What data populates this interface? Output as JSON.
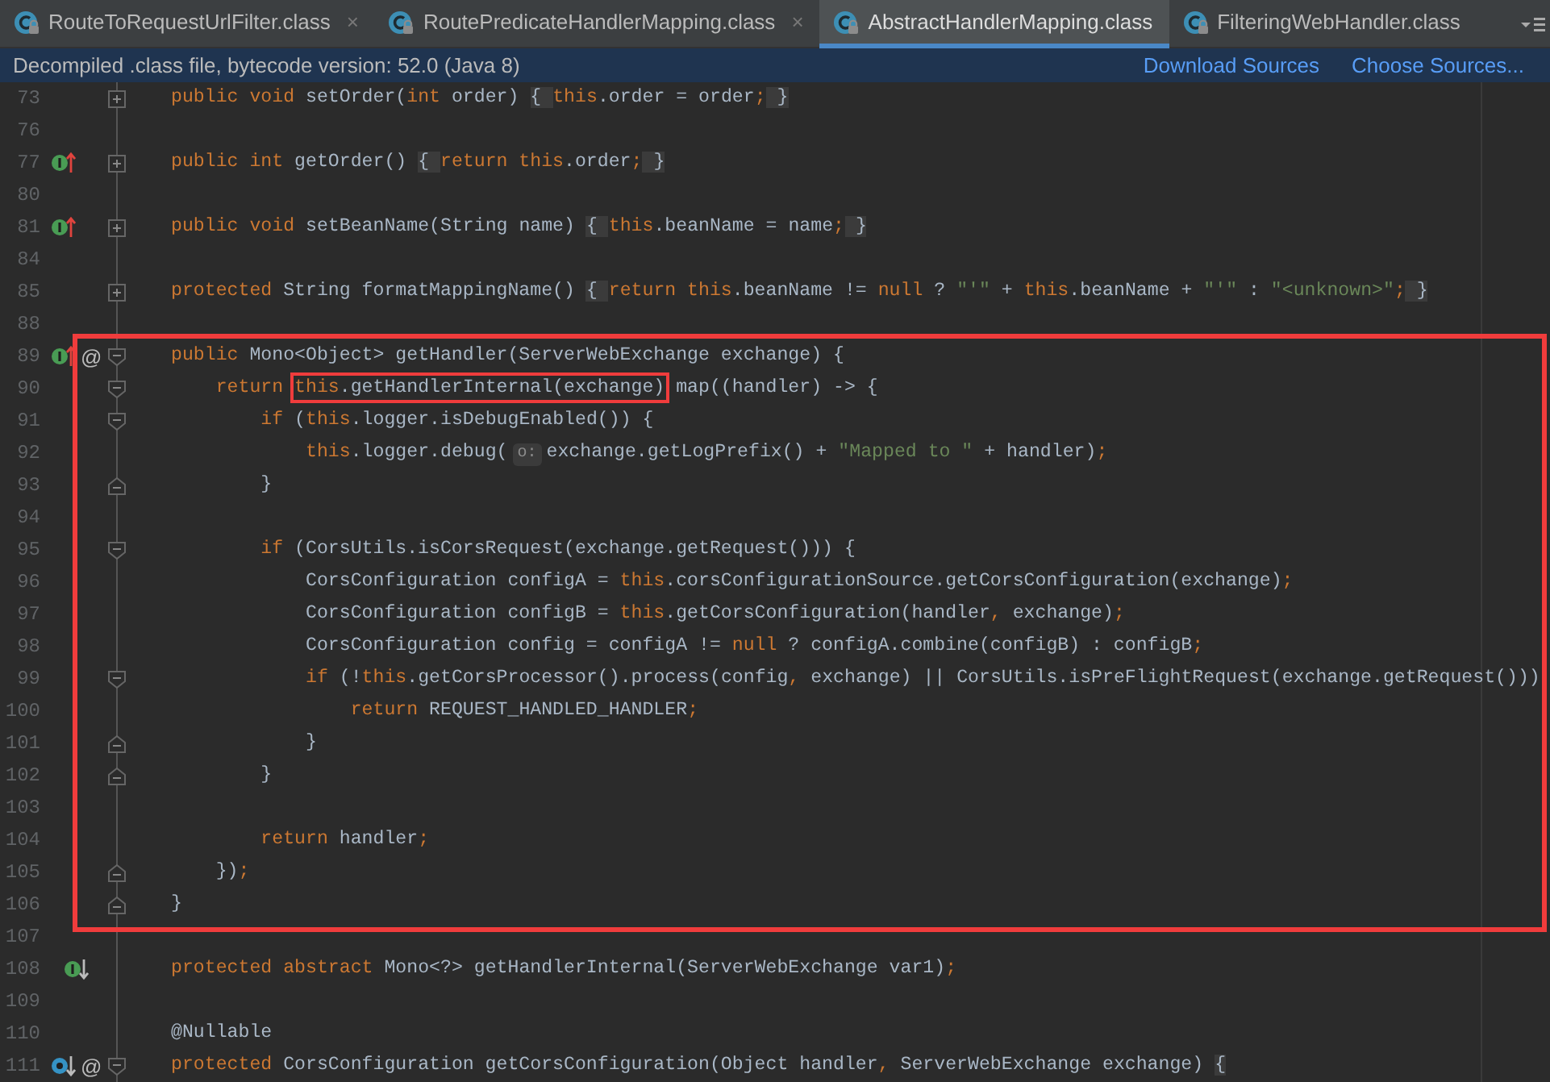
{
  "tabs": [
    {
      "label": "RouteToRequestUrlFilter.class",
      "selected": false,
      "close": "×"
    },
    {
      "label": "RoutePredicateHandlerMapping.class",
      "selected": false,
      "close": "×"
    },
    {
      "label": "AbstractHandlerMapping.class",
      "selected": true
    },
    {
      "label": "FilteringWebHandler.class",
      "selected": false
    }
  ],
  "notice": {
    "text": "Decompiled .class file, bytecode version: 52.0 (Java 8)",
    "links": [
      "Download Sources",
      "Choose Sources..."
    ]
  },
  "blocks": [
    {
      "framed": false,
      "lines": [
        {
          "number": "73",
          "fold": {
            "kind": "collapsed"
          },
          "tokens": [
            {
              "kind": "kw",
              "text": "public void "
            },
            {
              "kind": "plain",
              "text": "setOrder("
            },
            {
              "kind": "kw",
              "text": "int "
            },
            {
              "kind": "plain",
              "text": "order) "
            },
            {
              "kind": "fold",
              "text": "{ "
            },
            {
              "kind": "kw",
              "text": "this"
            },
            {
              "kind": "plain",
              "text": ".order = order"
            },
            {
              "kind": "kw",
              "text": ";"
            },
            {
              "kind": "fold",
              "text": " }"
            }
          ]
        },
        {
          "number": "76"
        },
        {
          "number": "77",
          "gutter": {
            "kind": "override"
          },
          "fold": {
            "kind": "collapsed"
          },
          "tokens": [
            {
              "kind": "kw",
              "text": "public int "
            },
            {
              "kind": "plain",
              "text": "getOrder() "
            },
            {
              "kind": "fold",
              "text": "{ "
            },
            {
              "kind": "kw",
              "text": "return this"
            },
            {
              "kind": "plain",
              "text": ".order"
            },
            {
              "kind": "kw",
              "text": ";"
            },
            {
              "kind": "fold",
              "text": " }"
            }
          ]
        },
        {
          "number": "80"
        },
        {
          "number": "81",
          "gutter": {
            "kind": "override"
          },
          "fold": {
            "kind": "collapsed"
          },
          "tokens": [
            {
              "kind": "kw",
              "text": "public void "
            },
            {
              "kind": "plain",
              "text": "setBeanName(String name) "
            },
            {
              "kind": "fold",
              "text": "{ "
            },
            {
              "kind": "kw",
              "text": "this"
            },
            {
              "kind": "plain",
              "text": ".beanName = name"
            },
            {
              "kind": "kw",
              "text": ";"
            },
            {
              "kind": "fold",
              "text": " }"
            }
          ]
        },
        {
          "number": "84"
        },
        {
          "number": "85",
          "fold": {
            "kind": "collapsed"
          },
          "tokens": [
            {
              "kind": "kw",
              "text": "protected "
            },
            {
              "kind": "plain",
              "text": "String formatMappingName() "
            },
            {
              "kind": "fold",
              "text": "{ "
            },
            {
              "kind": "kw",
              "text": "return this"
            },
            {
              "kind": "plain",
              "text": ".beanName != "
            },
            {
              "kind": "kw",
              "text": "null "
            },
            {
              "kind": "plain",
              "text": "? "
            },
            {
              "kind": "str",
              "text": "\"'\""
            },
            {
              "kind": "plain",
              "text": " + "
            },
            {
              "kind": "kw",
              "text": "this"
            },
            {
              "kind": "plain",
              "text": ".beanName + "
            },
            {
              "kind": "str",
              "text": "\"'\""
            },
            {
              "kind": "plain",
              "text": " : "
            },
            {
              "kind": "str",
              "text": "\"<unknown>\""
            },
            {
              "kind": "kw",
              "text": ";"
            },
            {
              "kind": "fold",
              "text": " }"
            }
          ]
        },
        {
          "number": "88"
        }
      ]
    },
    {
      "framed": true,
      "lines": [
        {
          "number": "89",
          "gutter": {
            "kind": "override"
          },
          "mark": "@",
          "fold": {
            "kind": "start"
          },
          "tokens": [
            {
              "kind": "kw",
              "text": "public "
            },
            {
              "kind": "plain",
              "text": "Mono<Object> getHandler(ServerWebExchange exchange) {"
            }
          ]
        },
        {
          "number": "90",
          "fold": {
            "kind": "start"
          },
          "tokens": [
            {
              "kind": "kw",
              "text": "    return "
            },
            {
              "kind": "box",
              "parts": [
                {
                  "kind": "kw",
                  "text": "this"
                },
                {
                  "kind": "plain",
                  "text": ".getHandlerInternal(exchange)"
                }
              ]
            },
            {
              "kind": "plain",
              "text": " map((handler) -> {"
            }
          ]
        },
        {
          "number": "91",
          "fold": {
            "kind": "start"
          },
          "tokens": [
            {
              "kind": "kw",
              "text": "        if "
            },
            {
              "kind": "plain",
              "text": "("
            },
            {
              "kind": "kw",
              "text": "this"
            },
            {
              "kind": "plain",
              "text": ".logger.isDebugEnabled()) {"
            }
          ]
        },
        {
          "number": "92",
          "tokens": [
            {
              "kind": "kw",
              "text": "            this"
            },
            {
              "kind": "plain",
              "text": ".logger.debug("
            },
            {
              "kind": "hint",
              "text": "o:"
            },
            {
              "kind": "plain",
              "text": "exchange.getLogPrefix() + "
            },
            {
              "kind": "str",
              "text": "\"Mapped to \""
            },
            {
              "kind": "plain",
              "text": " + handler)"
            },
            {
              "kind": "kw",
              "text": ";"
            }
          ]
        },
        {
          "number": "93",
          "fold": {
            "kind": "end"
          },
          "tokens": [
            {
              "kind": "plain",
              "text": "        }"
            }
          ]
        },
        {
          "number": "94"
        },
        {
          "number": "95",
          "fold": {
            "kind": "start"
          },
          "tokens": [
            {
              "kind": "kw",
              "text": "        if "
            },
            {
              "kind": "plain",
              "text": "(CorsUtils.isCorsRequest(exchange.getRequest())) {"
            }
          ]
        },
        {
          "number": "96",
          "tokens": [
            {
              "kind": "plain",
              "text": "            CorsConfiguration configA = "
            },
            {
              "kind": "kw",
              "text": "this"
            },
            {
              "kind": "plain",
              "text": ".corsConfigurationSource.getCorsConfiguration(exchange)"
            },
            {
              "kind": "kw",
              "text": ";"
            }
          ]
        },
        {
          "number": "97",
          "tokens": [
            {
              "kind": "plain",
              "text": "            CorsConfiguration configB = "
            },
            {
              "kind": "kw",
              "text": "this"
            },
            {
              "kind": "plain",
              "text": ".getCorsConfiguration(handler"
            },
            {
              "kind": "kw",
              "text": ", "
            },
            {
              "kind": "plain",
              "text": "exchange)"
            },
            {
              "kind": "kw",
              "text": ";"
            }
          ]
        },
        {
          "number": "98",
          "tokens": [
            {
              "kind": "plain",
              "text": "            CorsConfiguration config = configA != "
            },
            {
              "kind": "kw",
              "text": "null "
            },
            {
              "kind": "plain",
              "text": "? configA.combine(configB) : configB"
            },
            {
              "kind": "kw",
              "text": ";"
            }
          ]
        },
        {
          "number": "99",
          "fold": {
            "kind": "start"
          },
          "tokens": [
            {
              "kind": "kw",
              "text": "            if "
            },
            {
              "kind": "plain",
              "text": "(!"
            },
            {
              "kind": "kw",
              "text": "this"
            },
            {
              "kind": "plain",
              "text": ".getCorsProcessor().process(config"
            },
            {
              "kind": "kw",
              "text": ", "
            },
            {
              "kind": "plain",
              "text": "exchange) || CorsUtils.isPreFlightRequest(exchange.getRequest()))"
            }
          ]
        },
        {
          "number": "100",
          "tokens": [
            {
              "kind": "kw",
              "text": "                return "
            },
            {
              "kind": "plain",
              "text": "REQUEST_HANDLED_HANDLER"
            },
            {
              "kind": "kw",
              "text": ";"
            }
          ]
        },
        {
          "number": "101",
          "fold": {
            "kind": "end"
          },
          "tokens": [
            {
              "kind": "plain",
              "text": "            }"
            }
          ]
        },
        {
          "number": "102",
          "fold": {
            "kind": "end"
          },
          "tokens": [
            {
              "kind": "plain",
              "text": "        }"
            }
          ]
        },
        {
          "number": "103"
        },
        {
          "number": "104",
          "tokens": [
            {
              "kind": "kw",
              "text": "        return "
            },
            {
              "kind": "plain",
              "text": "handler"
            },
            {
              "kind": "kw",
              "text": ";"
            }
          ]
        },
        {
          "number": "105",
          "fold": {
            "kind": "end"
          },
          "tokens": [
            {
              "kind": "plain",
              "text": "    })"
            },
            {
              "kind": "kw",
              "text": ";"
            }
          ]
        },
        {
          "number": "106",
          "fold": {
            "kind": "end"
          },
          "tokens": [
            {
              "kind": "plain",
              "text": "}"
            }
          ]
        }
      ]
    },
    {
      "framed": false,
      "lines": [
        {
          "number": "107"
        },
        {
          "number": "108",
          "gutter": {
            "kind": "implemented"
          },
          "tokens": [
            {
              "kind": "kw",
              "text": "protected abstract "
            },
            {
              "kind": "plain",
              "text": "Mono<?> getHandlerInternal(ServerWebExchange var1)"
            },
            {
              "kind": "kw",
              "text": ";"
            }
          ]
        },
        {
          "number": "109"
        },
        {
          "number": "110",
          "tokens": [
            {
              "kind": "plain",
              "text": "@Nullable"
            }
          ]
        },
        {
          "number": "111",
          "gutter": {
            "kind": "overridden"
          },
          "mark": "@",
          "fold": {
            "kind": "start"
          },
          "tokens": [
            {
              "kind": "kw",
              "text": "protected "
            },
            {
              "kind": "plain",
              "text": "CorsConfiguration getCorsConfiguration(Object handler"
            },
            {
              "kind": "kw",
              "text": ", "
            },
            {
              "kind": "plain",
              "text": "ServerWebExchange exchange) "
            },
            {
              "kind": "fold",
              "text": "{"
            }
          ]
        }
      ]
    }
  ]
}
